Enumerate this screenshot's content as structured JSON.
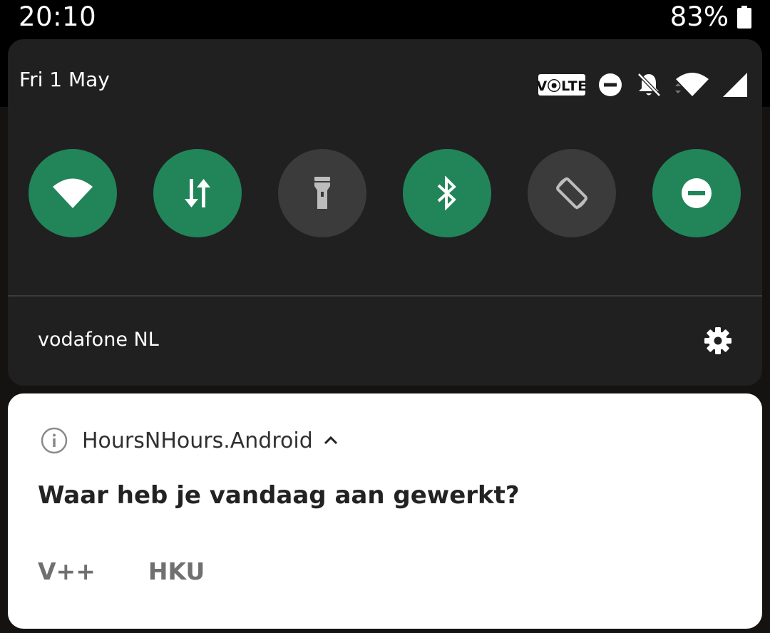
{
  "status_bar": {
    "time": "20:10",
    "battery_percent": "83%",
    "battery_icon": "battery-icon"
  },
  "quick_settings": {
    "date": "Fri 1 May",
    "status_icons": {
      "volte_label": "V⦿LTE",
      "icons": [
        "volte-icon",
        "do-not-disturb-icon",
        "bell-off-icon",
        "wifi-icon",
        "cellular-signal-icon"
      ]
    },
    "tiles": [
      {
        "name": "wifi",
        "icon": "wifi-icon",
        "state": "on"
      },
      {
        "name": "mobile-data",
        "icon": "data-arrows-icon",
        "state": "on"
      },
      {
        "name": "flashlight",
        "icon": "flashlight-icon",
        "state": "off"
      },
      {
        "name": "bluetooth",
        "icon": "bluetooth-icon",
        "state": "on"
      },
      {
        "name": "auto-rotate",
        "icon": "rotate-icon",
        "state": "off"
      },
      {
        "name": "do-not-disturb",
        "icon": "do-not-disturb-icon",
        "state": "on"
      }
    ],
    "carrier": "vodafone NL",
    "settings_icon": "gear-icon"
  },
  "notification": {
    "app_name": "HoursNHours.Android",
    "title": "Waar heb je vandaag aan gewerkt?",
    "actions": [
      "V++",
      "HKU"
    ]
  },
  "colors": {
    "tile_on": "#218559",
    "tile_off": "#3b3b3b",
    "panel_bg": "#202020"
  }
}
